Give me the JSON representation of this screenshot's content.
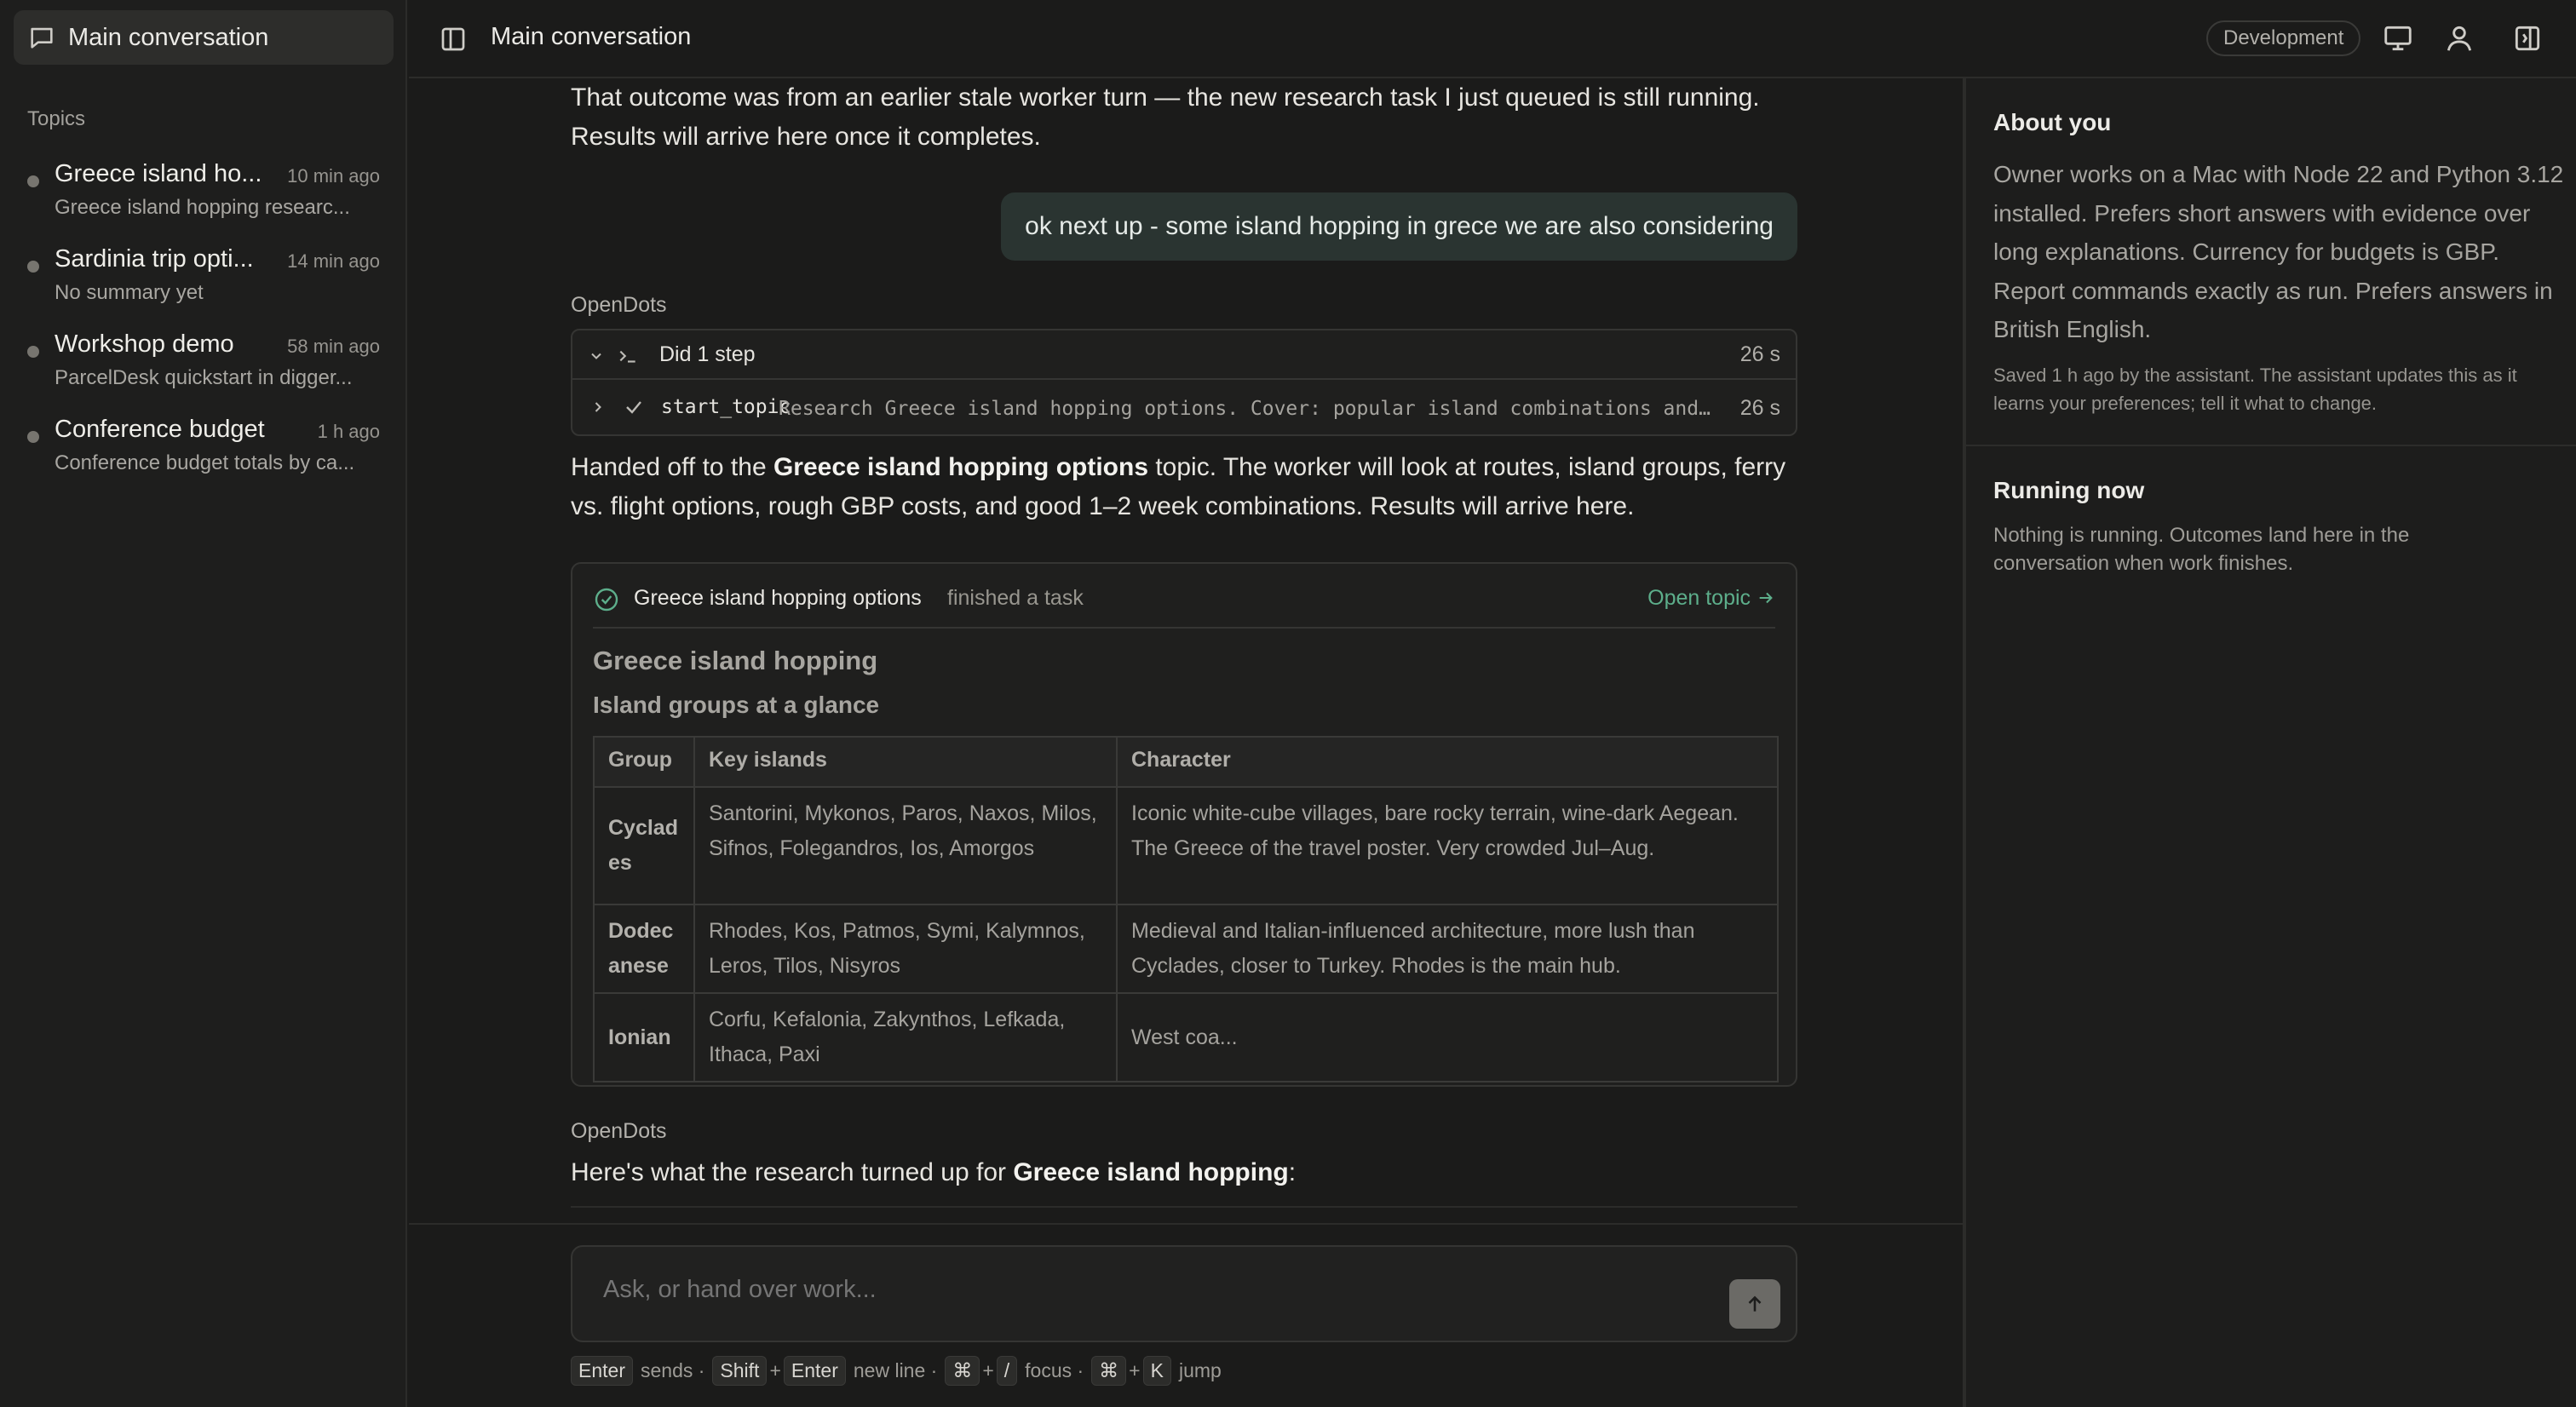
{
  "sidebar": {
    "main_conversation_label": "Main conversation",
    "topics_heading": "Topics",
    "topics": [
      {
        "title": "Greece island ho...",
        "time": "10 min ago",
        "summary": "Greece island hopping researc..."
      },
      {
        "title": "Sardinia trip opti...",
        "time": "14 min ago",
        "summary": "No summary yet"
      },
      {
        "title": "Workshop demo",
        "time": "58 min ago",
        "summary": "ParcelDesk quickstart in digger..."
      },
      {
        "title": "Conference budget",
        "time": "1 h ago",
        "summary": "Conference budget totals by ca..."
      }
    ]
  },
  "header": {
    "title": "Main conversation",
    "environment_badge": "Development",
    "icons": [
      "sidebar-toggle-icon",
      "monitor-icon",
      "user-icon",
      "panel-right-icon"
    ]
  },
  "conversation": {
    "message1": "That outcome was from an earlier stale worker turn — the new research task I just queued is still running. Results will arrive here once it completes.",
    "user_message": "ok next up - some island hopping in grece we are also considering",
    "sender": "OpenDots",
    "steps": {
      "summary_label": "Did 1 step",
      "summary_time": "26 s",
      "step_name": "start_topic",
      "step_desc": "Research Greece island hopping options. Cover: popular island combinations and routes, ferry vs. flight options, rough GBP costs",
      "step_time": "26 s"
    },
    "message2": {
      "before": "Handed off to the ",
      "bold": "Greece island hopping options",
      "after": " topic. The worker will look at routes, island groups, ferry vs. flight options, rough GBP costs, and good 1–2 week combinations. Results will arrive here."
    },
    "result_card": {
      "topic_name": "Greece island hopping options",
      "status_text": "finished a task",
      "open_topic_label": "Open topic",
      "heading": "Greece island hopping",
      "subheading": "Island groups at a glance",
      "table_headers": [
        "Group",
        "Key islands",
        "Character"
      ],
      "table_rows": [
        {
          "group": "Cyclades",
          "islands": "Santorini, Mykonos, Paros, Naxos, Milos, Sifnos, Folegandros, Ios, Amorgos",
          "character": "Iconic white-cube villages, bare rocky terrain, wine-dark Aegean. The Greece of the travel poster. Very crowded Jul–Aug."
        },
        {
          "group": "Dodecanese",
          "islands": "Rhodes, Kos, Patmos, Symi, Kalymnos, Leros, Tilos, Nisyros",
          "character": "Medieval and Italian-influenced architecture, more lush than Cyclades, closer to Turkey. Rhodes is the main hub."
        },
        {
          "group": "Ionian",
          "islands": "Corfu, Kefalonia, Zakynthos, Lefkada, Ithaca, Paxi",
          "character": "West coa..."
        }
      ]
    },
    "sender2": "OpenDots",
    "message3": {
      "before": "Here's what the research turned up for ",
      "bold": "Greece island hopping",
      "after": ":"
    }
  },
  "composer": {
    "placeholder": "Ask, or hand over work...",
    "hints": {
      "enter": "Enter",
      "sends": "sends ·",
      "shift": "Shift",
      "plus": "+",
      "enter2": "Enter",
      "new_line": "new line ·",
      "cmd": "⌘",
      "slash": "/",
      "focus": "focus ·",
      "k": "K",
      "jump": "jump"
    }
  },
  "right_panel": {
    "about_title": "About you",
    "about_body": "Owner works on a Mac with Node 22 and Python 3.12 installed. Prefers short answers with evidence over long explanations. Currency for budgets is GBP. Report commands exactly as run. Prefers answers in British English.",
    "about_note": "Saved 1 h ago by the assistant. The assistant updates this as it learns your preferences; tell it what to change.",
    "running_title": "Running now",
    "running_body": "Nothing is running. Outcomes land here in the conversation when work finishes."
  },
  "colors": {
    "background": "#1b1b1a",
    "accent_green": "#5dae8b",
    "user_bubble": "#2a3431"
  }
}
